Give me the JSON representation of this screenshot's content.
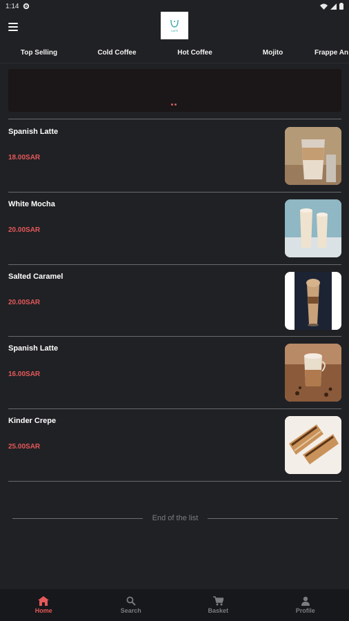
{
  "status_bar": {
    "time": "1:14"
  },
  "app_bar": {
    "logo_text": "CAFE"
  },
  "tabs": [
    {
      "label": "Top Selling",
      "active": true
    },
    {
      "label": "Cold Coffee",
      "active": false
    },
    {
      "label": "Hot Coffee",
      "active": false
    },
    {
      "label": "Mojito",
      "active": false
    },
    {
      "label": "Frappe An",
      "active": false
    }
  ],
  "products": [
    {
      "name": "Spanish Latte",
      "price": "18.00SAR",
      "image": "iced-latte-glass"
    },
    {
      "name": "White Mocha",
      "price": "20.00SAR",
      "image": "two-white-mocha-glasses"
    },
    {
      "name": "Salted Caramel",
      "price": "20.00SAR",
      "image": "caramel-frappe-cup"
    },
    {
      "name": "Spanish Latte",
      "price": "16.00SAR",
      "image": "hot-latte-glass"
    },
    {
      "name": "Kinder Crepe",
      "price": "25.00SAR",
      "image": "crepe-rolls"
    }
  ],
  "list_end": {
    "text": "End of the list"
  },
  "bottom_nav": [
    {
      "label": "Home",
      "icon": "home-icon",
      "active": true
    },
    {
      "label": "Search",
      "icon": "search-icon",
      "active": false
    },
    {
      "label": "Basket",
      "icon": "basket-icon",
      "active": false
    },
    {
      "label": "Profile",
      "icon": "profile-icon",
      "active": false
    }
  ],
  "colors": {
    "accent": "#e5585b",
    "background": "#202124",
    "nav_bg": "#17181b"
  }
}
